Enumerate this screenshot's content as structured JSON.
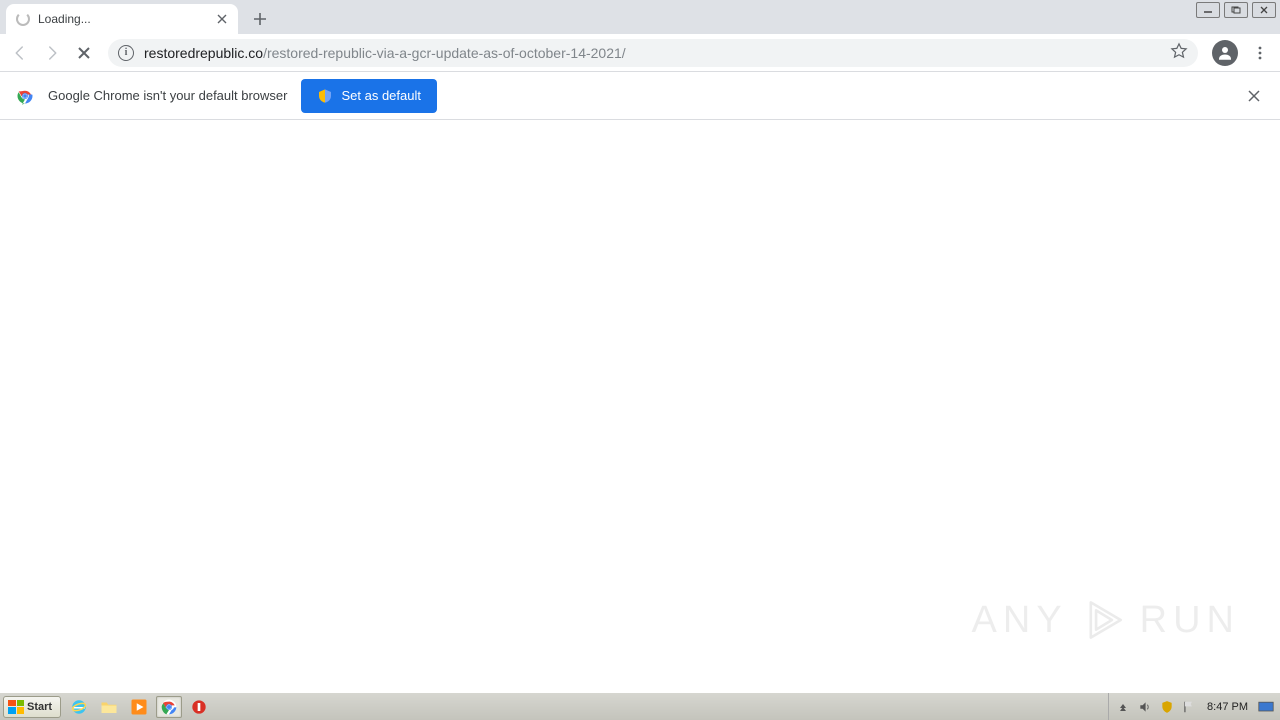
{
  "tab": {
    "title": "Loading..."
  },
  "url": {
    "domain": "restoredrepublic.co",
    "path": "/restored-republic-via-a-gcr-update-as-of-october-14-2021/"
  },
  "infobar": {
    "message": "Google Chrome isn't your default browser",
    "button": "Set as default"
  },
  "watermark": {
    "left": "ANY",
    "right": "RUN"
  },
  "taskbar": {
    "start": "Start",
    "clock": "8:47 PM"
  }
}
